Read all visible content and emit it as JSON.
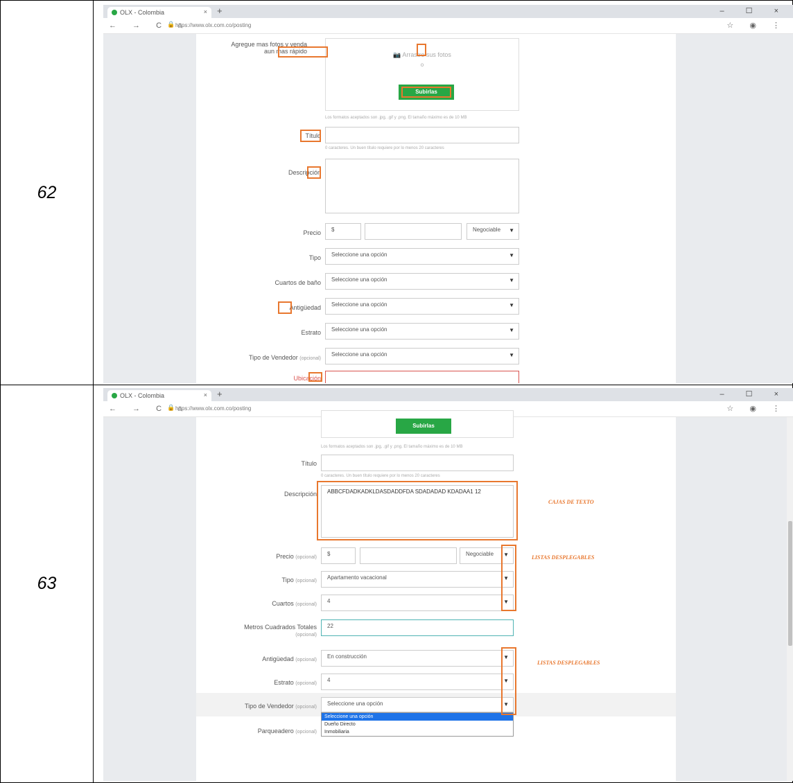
{
  "rows": [
    {
      "number": "62"
    },
    {
      "number": "63"
    }
  ],
  "browser": {
    "tab_title": "OLX - Colombia",
    "tab_close": "×",
    "new_tab": "+",
    "url": "https://www.olx.com.co/posting",
    "nav": "← → C ⌂",
    "window_controls": "– ☐ ×",
    "addr_right": "☆ ◉ ⋮"
  },
  "form62": {
    "photos_label": "Agregue mas fotos y venda",
    "photos_label2": "aun mas rápido",
    "photos_hint": "Arrastre sus fotos",
    "photos_or": "o",
    "upload_button": "Subirlas",
    "formats_help": "Los formatos aceptados son .jpg, .gif y .png. El tamaño máximo es de 10 MB",
    "title_label": "Título",
    "title_help": "0 caracteres. Un buen título requiere por lo menos 20 caracteres",
    "description_label": "Descripción",
    "price_label": "Precio",
    "price_currency": "$",
    "negotiable": "Negociable",
    "type_label": "Tipo",
    "bathrooms_label": "Cuartos de baño",
    "age_label": "Antigüedad",
    "stratum_label": "Estrato",
    "seller_label": "Tipo de Vendedor",
    "optional": "(opcional)",
    "select_placeholder": "Seleccione una opción",
    "location_label": "Ubicación"
  },
  "form63": {
    "upload_button": "Subirlas",
    "formats_help": "Los formatos aceptados son .jpg, .gif y .png. El tamaño máximo es de 10 MB",
    "title_label": "Título",
    "title_help": "0 caracteres. Un buen título requiere por lo menos 20 caracteres",
    "description_label": "Descripción",
    "description_value": "ABBCFDADKADKLDASDADDFDA SDADADAD KDADAA1 12",
    "price_label": "Precio",
    "price_currency": "$",
    "negotiable": "Negociable",
    "type_label": "Tipo",
    "type_value": "Apartamento vacacional",
    "rooms_label": "Cuartos",
    "rooms_value": "4",
    "area_label": "Metros Cuadrados Totales",
    "area_value": "22",
    "age_label": "Antigüedad",
    "age_value": "En construcción",
    "stratum_label": "Estrato",
    "stratum_value": "4",
    "seller_label": "Tipo de Vendedor",
    "seller_value": "Seleccione una opción",
    "parking_label": "Parqueadero",
    "optional": "(opcional)",
    "dropdown_options": [
      "Seleccione una opción",
      "Dueño Directo",
      "Inmobiliaria"
    ],
    "annotations": {
      "text_boxes": "CAJAS DE TEXTO",
      "dropdowns1": "LISTAS DESPLEGABLES",
      "dropdowns2": "LISTAS DESPLEGABLES"
    }
  },
  "colors": {
    "accent": "#28a745",
    "highlight": "#e8772e",
    "selected": "#1e73e8"
  }
}
